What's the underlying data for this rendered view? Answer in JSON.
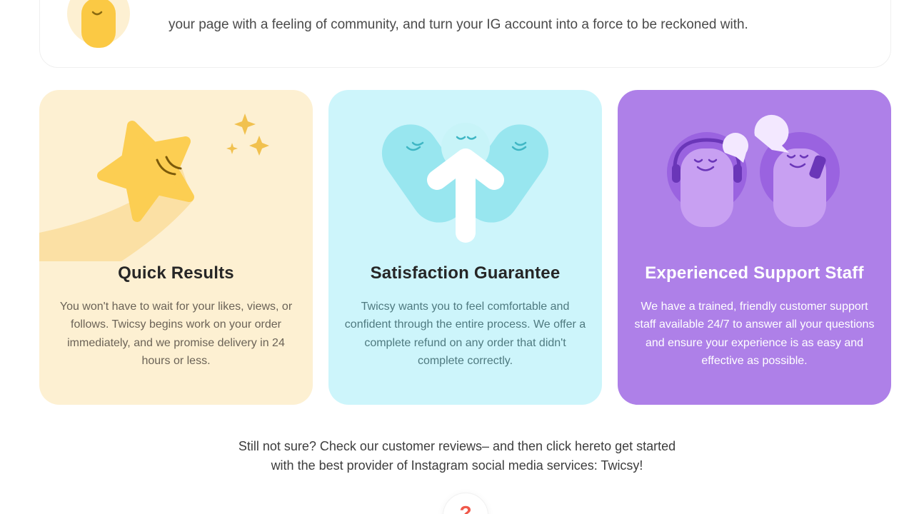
{
  "top_section": {
    "text": "your page with a feeling of community, and turn your IG account into a force to be reckoned with."
  },
  "features": [
    {
      "title": "Quick Results",
      "body": "You won't have to wait for your likes, views, or follows. Twicsy begins work on your order immediately, and we promise delivery in 24 hours or less.",
      "icon": "star-icon",
      "color": "#fdf0d2"
    },
    {
      "title": "Satisfaction Guarantee",
      "body": "Twicsy wants you to feel comfortable and confident through the entire process. We offer a complete refund on any order that didn't complete correctly.",
      "icon": "arrow-up-icon",
      "color": "#cdf5fb"
    },
    {
      "title": "Experienced Support Staff",
      "body": "We have a trained, friendly customer support staff available 24/7 to answer all your questions and ensure your experience is as easy and effective as possible.",
      "icon": "support-agents-icon",
      "color": "#ae80e8"
    }
  ],
  "cta": {
    "line1": "Still not sure? Check our customer reviews– and then click hereto get started",
    "line2": "with the best provider of Instagram social media services: Twicsy!"
  },
  "help": {
    "symbol": "?",
    "icon": "question-icon"
  }
}
